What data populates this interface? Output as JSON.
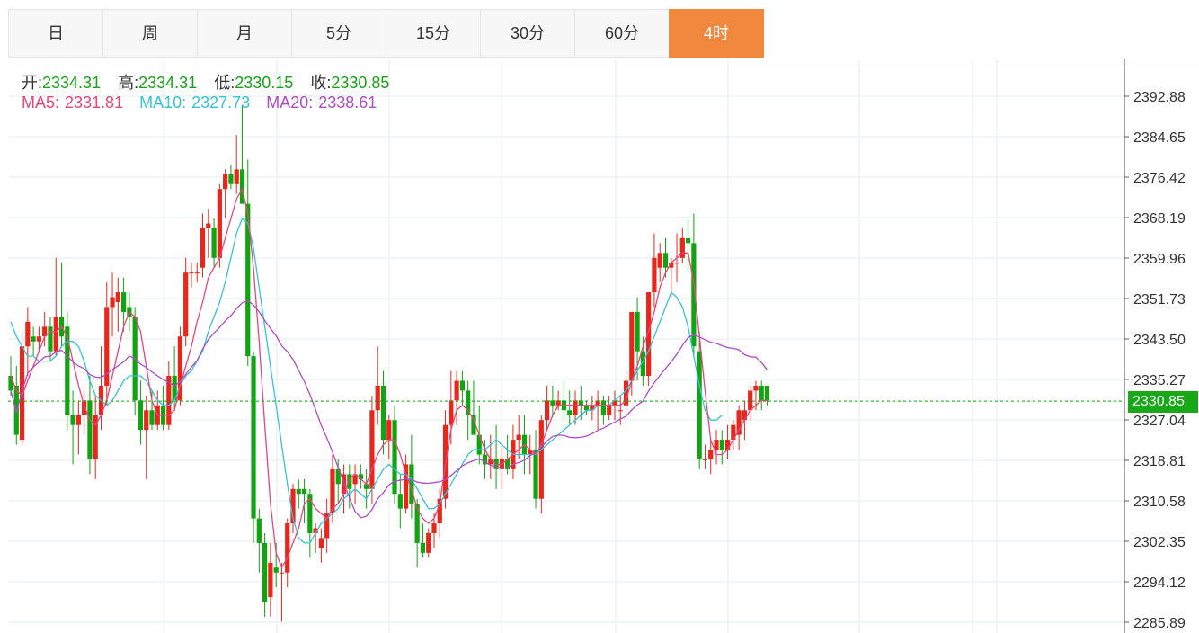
{
  "tabs": [
    {
      "label": "日",
      "active": false
    },
    {
      "label": "周",
      "active": false
    },
    {
      "label": "月",
      "active": false
    },
    {
      "label": "5分",
      "active": false
    },
    {
      "label": "15分",
      "active": false
    },
    {
      "label": "30分",
      "active": false
    },
    {
      "label": "60分",
      "active": false
    },
    {
      "label": "4时",
      "active": true
    }
  ],
  "ohlc": {
    "open_label": "开:",
    "open": "2334.31",
    "high_label": "高:",
    "high": "2334.31",
    "low_label": "低:",
    "low": "2330.15",
    "close_label": "收:",
    "close": "2330.85"
  },
  "ma": [
    {
      "label": "MA5:",
      "value": "2331.81",
      "color": "#e8457a"
    },
    {
      "label": "MA10:",
      "value": "2327.73",
      "color": "#34c3d8"
    },
    {
      "label": "MA20:",
      "value": "2338.61",
      "color": "#b04cc4"
    }
  ],
  "last_price": "2330.85",
  "colors": {
    "up": "#e8261c",
    "down": "#10a410",
    "accent": "#f0883e",
    "grid": "#e6eef2"
  },
  "chart_data": {
    "type": "candlestick",
    "y_ticks": [
      "2392.88",
      "2384.65",
      "2376.42",
      "2368.19",
      "2359.96",
      "2351.73",
      "2343.50",
      "2335.27",
      "2327.04",
      "2318.81",
      "2310.58",
      "2302.35",
      "2294.12",
      "2285.89"
    ],
    "ylim": [
      2285.89,
      2392.88
    ],
    "last_price": 2330.85,
    "candles": [
      [
        2336,
        2340,
        2332,
        2333
      ],
      [
        2334,
        2338,
        2322,
        2324
      ],
      [
        2323,
        2345,
        2322,
        2342
      ],
      [
        2342,
        2350,
        2336,
        2347
      ],
      [
        2344,
        2346,
        2340,
        2343
      ],
      [
        2343,
        2346,
        2341,
        2344
      ],
      [
        2344,
        2349,
        2342,
        2346
      ],
      [
        2346,
        2348,
        2339,
        2341
      ],
      [
        2341,
        2360,
        2340,
        2348
      ],
      [
        2348,
        2359,
        2342,
        2344
      ],
      [
        2346,
        2349,
        2325,
        2328
      ],
      [
        2328,
        2333,
        2318,
        2326
      ],
      [
        2326,
        2331,
        2320,
        2328
      ],
      [
        2328,
        2333,
        2324,
        2331
      ],
      [
        2331,
        2336,
        2316,
        2319
      ],
      [
        2319,
        2332,
        2315,
        2328
      ],
      [
        2328,
        2342,
        2325,
        2334
      ],
      [
        2334,
        2355,
        2330,
        2350
      ],
      [
        2350,
        2357,
        2344,
        2352
      ],
      [
        2351,
        2356,
        2345,
        2353
      ],
      [
        2353,
        2356,
        2345,
        2349
      ],
      [
        2350,
        2353,
        2345,
        2348
      ],
      [
        2348,
        2350,
        2328,
        2331
      ],
      [
        2331,
        2335,
        2322,
        2325
      ],
      [
        2325,
        2332,
        2315,
        2329
      ],
      [
        2329,
        2333,
        2325,
        2326
      ],
      [
        2326,
        2333,
        2325,
        2330
      ],
      [
        2330,
        2334,
        2325,
        2326
      ],
      [
        2326,
        2339,
        2325,
        2336
      ],
      [
        2336,
        2342,
        2329,
        2331
      ],
      [
        2331,
        2346,
        2330,
        2344
      ],
      [
        2344,
        2360,
        2342,
        2357
      ],
      [
        2357,
        2359,
        2354,
        2357
      ],
      [
        2357,
        2359,
        2355,
        2357
      ],
      [
        2358,
        2369,
        2356,
        2366
      ],
      [
        2366,
        2370,
        2360,
        2367
      ],
      [
        2366,
        2368,
        2358,
        2360
      ],
      [
        2360,
        2375,
        2358,
        2374
      ],
      [
        2374,
        2378,
        2368,
        2377
      ],
      [
        2377,
        2379,
        2374,
        2375
      ],
      [
        2375,
        2385,
        2373,
        2378
      ],
      [
        2378,
        2391,
        2371,
        2371
      ],
      [
        2371,
        2380,
        2338,
        2340
      ],
      [
        2340,
        2341,
        2302,
        2307
      ],
      [
        2307,
        2309,
        2296,
        2302
      ],
      [
        2302,
        2304,
        2287,
        2290
      ],
      [
        2291,
        2302,
        2287,
        2298
      ],
      [
        2297,
        2302,
        2293,
        2296
      ],
      [
        2296,
        2298,
        2286,
        2296
      ],
      [
        2296,
        2307,
        2293,
        2306
      ],
      [
        2306,
        2314,
        2304,
        2313
      ],
      [
        2313,
        2315,
        2309,
        2312
      ],
      [
        2313,
        2315,
        2306,
        2312
      ],
      [
        2312,
        2313,
        2299,
        2304
      ],
      [
        2304,
        2306,
        2300,
        2305
      ],
      [
        2301,
        2305,
        2298,
        2303
      ],
      [
        2303,
        2311,
        2300,
        2308
      ],
      [
        2308,
        2320,
        2306,
        2317
      ],
      [
        2317,
        2319,
        2310,
        2314
      ],
      [
        2312,
        2318,
        2308,
        2316
      ],
      [
        2316,
        2318,
        2309,
        2313
      ],
      [
        2314,
        2318,
        2310,
        2316
      ],
      [
        2316,
        2318,
        2313,
        2315
      ],
      [
        2314,
        2317,
        2309,
        2313
      ],
      [
        2313,
        2332,
        2310,
        2329
      ],
      [
        2329,
        2342,
        2326,
        2334
      ],
      [
        2334,
        2337,
        2320,
        2323
      ],
      [
        2323,
        2328,
        2319,
        2327
      ],
      [
        2327,
        2330,
        2310,
        2312
      ],
      [
        2312,
        2316,
        2305,
        2309
      ],
      [
        2309,
        2320,
        2308,
        2318
      ],
      [
        2318,
        2324,
        2307,
        2310
      ],
      [
        2310,
        2311,
        2297,
        2302
      ],
      [
        2302,
        2306,
        2299,
        2300
      ],
      [
        2300,
        2305,
        2299,
        2304
      ],
      [
        2304,
        2308,
        2301,
        2306
      ],
      [
        2306,
        2313,
        2303,
        2311
      ],
      [
        2311,
        2329,
        2309,
        2326
      ],
      [
        2326,
        2337,
        2322,
        2331
      ],
      [
        2331,
        2337,
        2326,
        2335
      ],
      [
        2335,
        2337,
        2330,
        2333
      ],
      [
        2333,
        2335,
        2323,
        2328
      ],
      [
        2328,
        2335,
        2324,
        2324
      ],
      [
        2324,
        2330,
        2318,
        2320
      ],
      [
        2320,
        2323,
        2315,
        2318
      ],
      [
        2318,
        2324,
        2315,
        2319
      ],
      [
        2319,
        2326,
        2313,
        2317
      ],
      [
        2317,
        2322,
        2313,
        2319
      ],
      [
        2319,
        2324,
        2316,
        2317
      ],
      [
        2317,
        2326,
        2315,
        2323
      ],
      [
        2323,
        2328,
        2319,
        2324
      ],
      [
        2324,
        2328,
        2316,
        2320
      ],
      [
        2320,
        2324,
        2316,
        2321
      ],
      [
        2321,
        2325,
        2309,
        2311
      ],
      [
        2311,
        2328,
        2308,
        2327
      ],
      [
        2327,
        2334,
        2325,
        2331
      ],
      [
        2331,
        2334,
        2328,
        2330
      ],
      [
        2330,
        2333,
        2329,
        2331
      ],
      [
        2331,
        2335,
        2327,
        2329
      ],
      [
        2329,
        2333,
        2326,
        2328
      ],
      [
        2328,
        2333,
        2326,
        2331
      ],
      [
        2331,
        2334,
        2327,
        2330
      ],
      [
        2330,
        2331,
        2328,
        2329
      ],
      [
        2329,
        2332,
        2327,
        2330
      ],
      [
        2330,
        2333,
        2325,
        2331
      ],
      [
        2331,
        2332,
        2326,
        2328
      ],
      [
        2328,
        2332,
        2327,
        2330
      ],
      [
        2330,
        2333,
        2327,
        2331
      ],
      [
        2329,
        2332,
        2326,
        2329
      ],
      [
        2330,
        2337,
        2329,
        2335
      ],
      [
        2335,
        2348,
        2332,
        2349
      ],
      [
        2349,
        2352,
        2335,
        2341
      ],
      [
        2341,
        2344,
        2334,
        2336
      ],
      [
        2336,
        2350,
        2334,
        2353
      ],
      [
        2353,
        2365,
        2350,
        2360
      ],
      [
        2358,
        2363,
        2355,
        2361
      ],
      [
        2361,
        2364,
        2356,
        2358
      ],
      [
        2358,
        2360,
        2352,
        2359
      ],
      [
        2359,
        2365,
        2355,
        2359
      ],
      [
        2360,
        2366,
        2359,
        2364
      ],
      [
        2364,
        2368,
        2357,
        2363
      ],
      [
        2363,
        2369,
        2340,
        2342
      ],
      [
        2341,
        2345,
        2317,
        2319
      ],
      [
        2319,
        2322,
        2317,
        2319
      ],
      [
        2319,
        2323,
        2316,
        2321
      ],
      [
        2321,
        2325,
        2318,
        2323
      ],
      [
        2323,
        2325,
        2318,
        2321
      ],
      [
        2321,
        2326,
        2319,
        2323
      ],
      [
        2323,
        2327,
        2321,
        2326
      ],
      [
        2324,
        2330,
        2321,
        2329
      ],
      [
        2327,
        2331,
        2323,
        2329
      ],
      [
        2329,
        2334,
        2327,
        2333
      ],
      [
        2333,
        2335,
        2329,
        2334
      ],
      [
        2334,
        2335,
        2329,
        2331
      ],
      [
        2334,
        2334,
        2330,
        2331
      ]
    ],
    "ma5": [
      2336,
      2333,
      2332,
      2335,
      2338,
      2341,
      2344,
      2345,
      2345,
      2346,
      2344,
      2339,
      2334,
      2330,
      2327,
      2326,
      2328,
      2331,
      2336,
      2341,
      2346,
      2349,
      2348,
      2345,
      2338,
      2331,
      2328,
      2328,
      2328,
      2329,
      2334,
      2338,
      2342,
      2347,
      2351,
      2356,
      2358,
      2360,
      2364,
      2368,
      2372,
      2374,
      2369,
      2358,
      2343,
      2326,
      2310,
      2300,
      2297,
      2299,
      2302,
      2305,
      2310,
      2311,
      2309,
      2308,
      2307,
      2309,
      2310,
      2312,
      2315,
      2316,
      2315,
      2314,
      2317,
      2320,
      2322,
      2323,
      2323,
      2320,
      2316,
      2313,
      2309,
      2307,
      2306,
      2307,
      2310,
      2318,
      2325,
      2329,
      2330,
      2329,
      2327,
      2324,
      2321,
      2319,
      2318,
      2318,
      2319,
      2320,
      2321,
      2322,
      2321,
      2320,
      2322,
      2325,
      2328,
      2330,
      2330,
      2330,
      2330,
      2330,
      2330,
      2330,
      2330,
      2330,
      2330,
      2330,
      2330,
      2331,
      2335,
      2338,
      2342,
      2345,
      2349,
      2354,
      2357,
      2359,
      2360,
      2361,
      2361,
      2355,
      2344,
      2333,
      2323,
      2320,
      2320,
      2321,
      2323,
      2325,
      2327,
      2329,
      2330,
      2331,
      2331
    ],
    "ma10": [
      2347,
      2344,
      2342,
      2340,
      2340,
      2339,
      2339,
      2339,
      2340,
      2342,
      2343,
      2343,
      2342,
      2339,
      2335,
      2332,
      2331,
      2330,
      2331,
      2333,
      2335,
      2336,
      2336,
      2336,
      2335,
      2333,
      2331,
      2330,
      2330,
      2331,
      2334,
      2336,
      2337,
      2339,
      2341,
      2345,
      2348,
      2351,
      2355,
      2360,
      2365,
      2368,
      2367,
      2362,
      2354,
      2346,
      2338,
      2330,
      2322,
      2314,
      2307,
      2303,
      2302,
      2302,
      2304,
      2306,
      2307,
      2308,
      2309,
      2311,
      2312,
      2313,
      2312,
      2311,
      2313,
      2315,
      2317,
      2318,
      2317,
      2316,
      2316,
      2315,
      2313,
      2311,
      2309,
      2309,
      2310,
      2312,
      2314,
      2316,
      2318,
      2320,
      2321,
      2321,
      2321,
      2322,
      2323,
      2322,
      2321,
      2320,
      2320,
      2320,
      2320,
      2320,
      2321,
      2322,
      2323,
      2324,
      2325,
      2326,
      2327,
      2328,
      2329,
      2329,
      2330,
      2330,
      2330,
      2331,
      2332,
      2333,
      2335,
      2337,
      2339,
      2341,
      2344,
      2347,
      2350,
      2353,
      2352,
      2350,
      2346,
      2340,
      2334,
      2329,
      2327,
      2327,
      2328
    ]
  }
}
